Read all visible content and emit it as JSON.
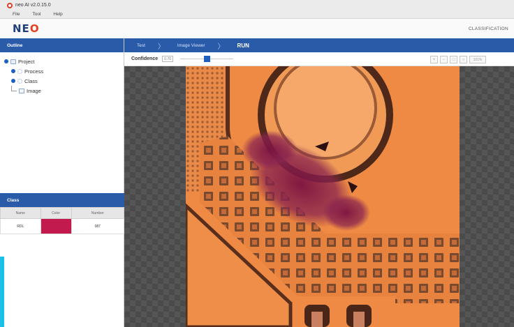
{
  "window": {
    "title": "neo AI v2.0.15.0"
  },
  "menu": [
    "File",
    "Tool",
    "Help"
  ],
  "brand": {
    "logo_main": "NE",
    "logo_accent": "O",
    "mode_label": "CLASSIFICATION"
  },
  "outline": {
    "header": "Outline",
    "tree": [
      {
        "label": "Project",
        "level": 0
      },
      {
        "label": "Process",
        "level": 1
      },
      {
        "label": "Class",
        "level": 1
      },
      {
        "label": "Image",
        "level": 1
      }
    ]
  },
  "class_panel": {
    "header": "Class",
    "columns": [
      "Name",
      "Color",
      "Number"
    ],
    "rows": [
      {
        "name": "RDL",
        "color": "#c2194f",
        "number": "087"
      }
    ]
  },
  "breadcrumb": [
    "Test",
    "Image Viewer",
    "RUN"
  ],
  "toolbar": {
    "confidence_label": "Confidence",
    "confidence_value": "0.70",
    "slider_fraction": 0.5,
    "zoom_label": "101%",
    "tools": [
      "zoom-in-icon",
      "zoom-out-icon",
      "fit-icon",
      "search-icon"
    ]
  },
  "colors": {
    "accent": "#2a5ba8",
    "logo_accent": "#e2401f",
    "defect": "#8a1f4a",
    "cyan": "#1ac0e8"
  }
}
